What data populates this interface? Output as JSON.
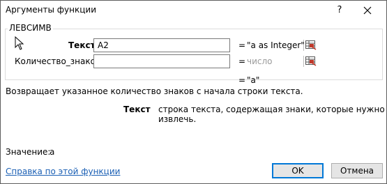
{
  "window": {
    "title": "Аргументы функции",
    "help_glyph": "?",
    "close_icon": "close-icon"
  },
  "function": {
    "name": "ЛЕВСИМВ",
    "args": [
      {
        "label": "Текст",
        "value": "A2",
        "equals": "=",
        "result": "\"a as Integer\""
      },
      {
        "label": "Количество_знаков",
        "value": "",
        "equals": "=",
        "result": "число"
      }
    ],
    "overall_equals": "=",
    "overall_result": "\"a\"",
    "description": "Возвращает указанное количество знаков с начала строки текста.",
    "arg_help_name": "Текст",
    "arg_help_text": "строка текста, содержащая знаки, которые нужно извлечь."
  },
  "footer": {
    "value_label": "Значение:",
    "value": "a",
    "help_link": "Справка по этой функции",
    "ok_label": "OK",
    "cancel_label": "Отмена"
  },
  "colors": {
    "link": "#1a5fb4",
    "placeholder_result": "#9a9a9a",
    "default_button_border": "#0078d7"
  }
}
